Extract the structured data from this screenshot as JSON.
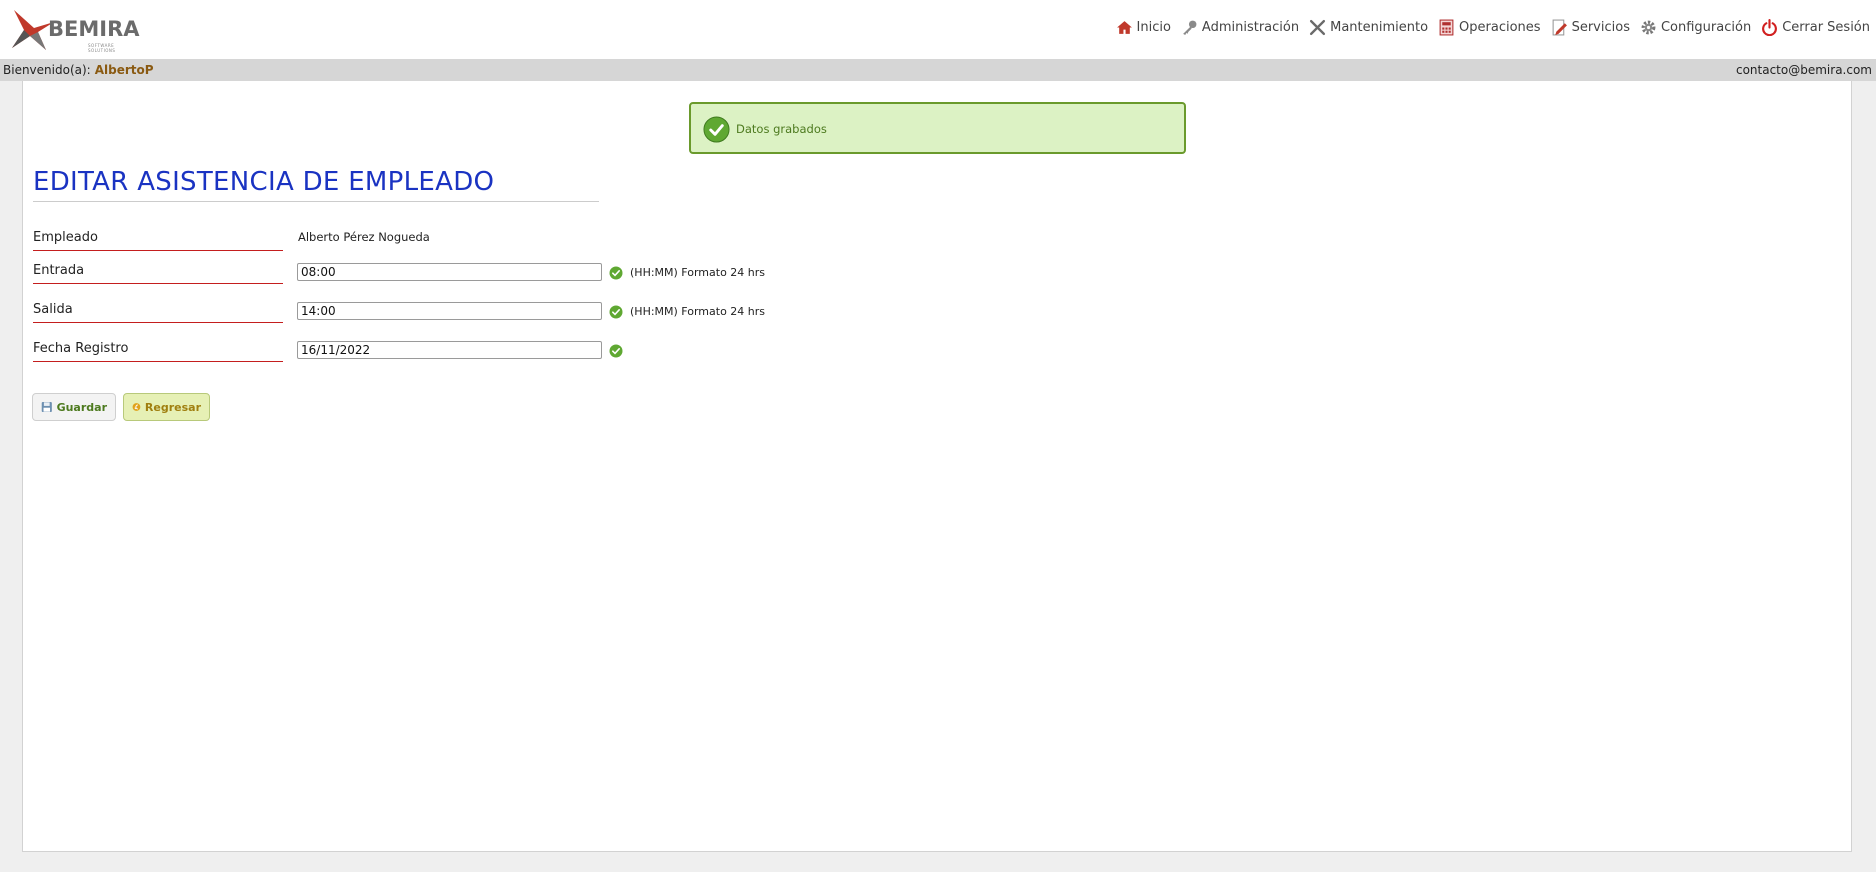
{
  "header": {
    "logo_text": "BEMIRA",
    "logo_subtext": "SOFTWARE SOLUTIONS",
    "nav": [
      {
        "label": "Inicio",
        "icon": "home-icon"
      },
      {
        "label": "Administración",
        "icon": "key-icon"
      },
      {
        "label": "Mantenimiento",
        "icon": "tools-icon"
      },
      {
        "label": "Operaciones",
        "icon": "calculator-icon"
      },
      {
        "label": "Servicios",
        "icon": "document-edit-icon"
      },
      {
        "label": "Configuración",
        "icon": "gear-icon"
      },
      {
        "label": "Cerrar Sesión",
        "icon": "power-icon"
      }
    ]
  },
  "welcome_bar": {
    "greeting": "Bienvenido(a):",
    "user": "AlbertoP",
    "email": "contacto@bemira.com"
  },
  "alert": {
    "message": "Datos grabados",
    "icon": "check-circle-icon"
  },
  "page_title": "EDITAR ASISTENCIA DE EMPLEADO",
  "form": {
    "empleado_label": "Empleado",
    "empleado_value": "Alberto Pérez Nogueda",
    "entrada_label": "Entrada",
    "entrada_value": "08:00",
    "entrada_hint": "(HH:MM) Formato 24 hrs",
    "salida_label": "Salida",
    "salida_value": "14:00",
    "salida_hint": "(HH:MM) Formato 24 hrs",
    "fecha_label": "Fecha Registro",
    "fecha_value": "16/11/2022"
  },
  "buttons": {
    "save_label": "Guardar",
    "back_label": "Regresar"
  },
  "colors": {
    "title": "#1a33c2",
    "label_underline": "#c41e1e",
    "alert_bg": "#dcf2c4",
    "alert_border": "#6a9a2c",
    "welcome_user": "#8a5a12"
  }
}
